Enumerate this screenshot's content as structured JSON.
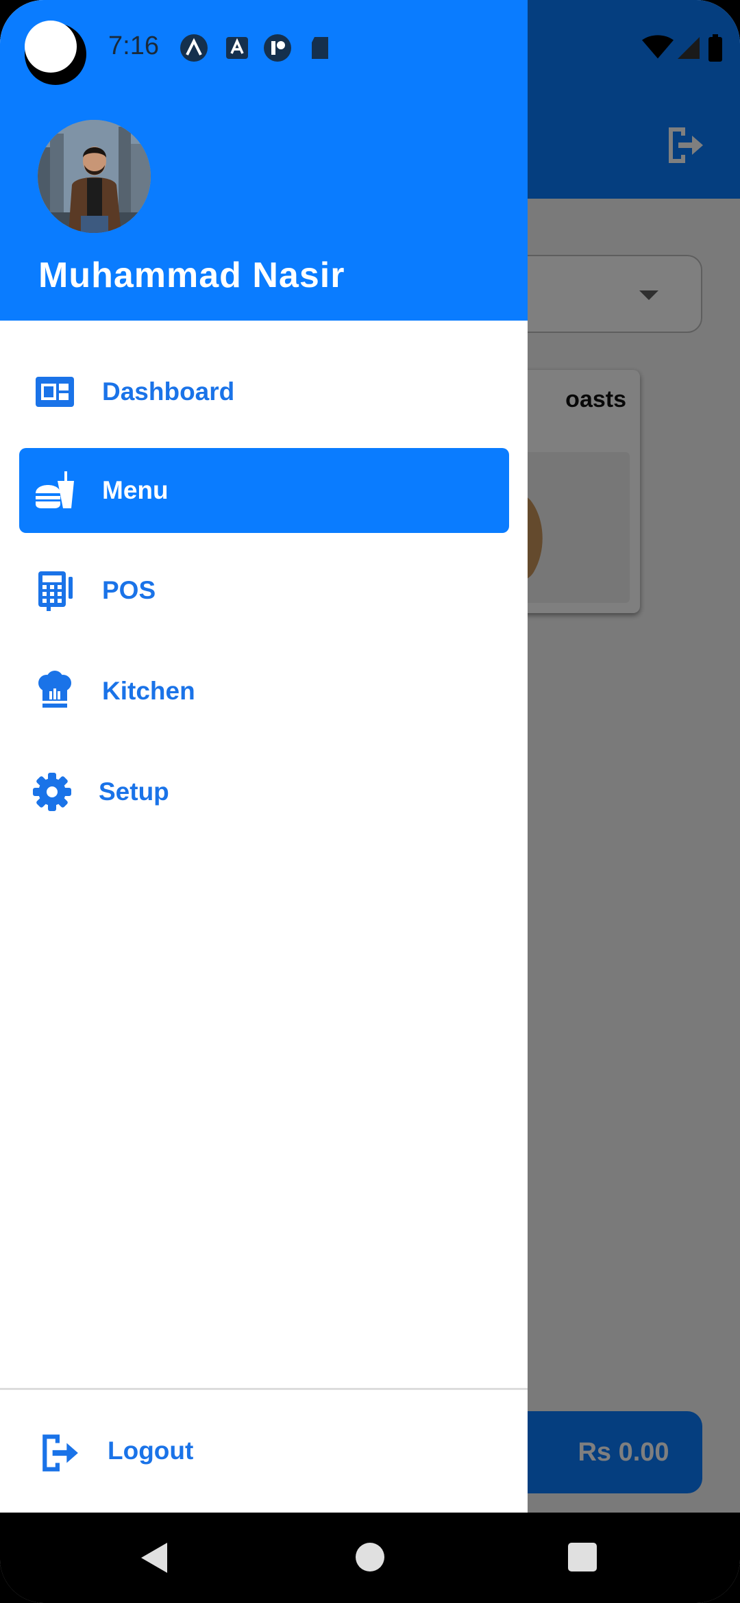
{
  "status_bar": {
    "time": "7:16",
    "notification_icons": [
      "arc-app-icon",
      "a-square-app-icon",
      "record-app-icon",
      "sd-card-icon"
    ],
    "system_icons": [
      "wifi-icon",
      "cell-signal-icon",
      "battery-icon"
    ]
  },
  "background_app": {
    "logout_icon": "exit-icon",
    "card_title": "oasts",
    "total_button_label": "Rs 0.00"
  },
  "drawer": {
    "user_name": "Muhammad Nasir",
    "items": [
      {
        "label": "Dashboard",
        "icon": "dashboard-icon",
        "active": false
      },
      {
        "label": "Menu",
        "icon": "burger-drink-icon",
        "active": true
      },
      {
        "label": "POS",
        "icon": "calculator-icon",
        "active": false
      },
      {
        "label": "Kitchen",
        "icon": "chef-hat-icon",
        "active": false
      },
      {
        "label": "Setup",
        "icon": "gear-icon",
        "active": false
      }
    ],
    "logout_label": "Logout"
  },
  "colors": {
    "primary": "#0a7cff",
    "nav_text": "#1a73e8",
    "scrim": "rgba(0,0,0,0.5)"
  }
}
